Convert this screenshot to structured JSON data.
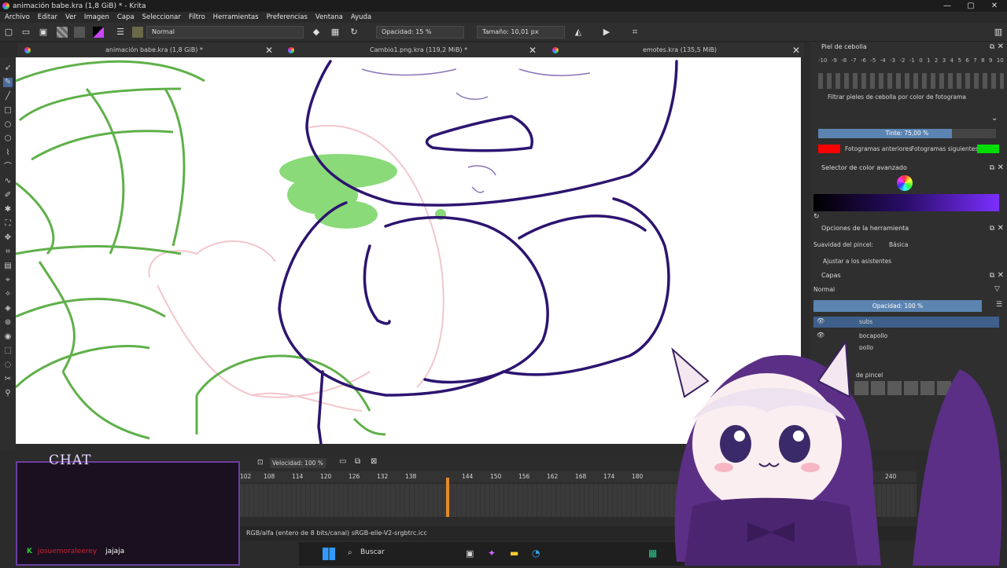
{
  "window": {
    "title": "animación babe.kra (1,8 GiB) * - Krita",
    "minimize": "—",
    "maximize": "▢",
    "close": "✕"
  },
  "menu": [
    "Archivo",
    "Editar",
    "Ver",
    "Imagen",
    "Capa",
    "Seleccionar",
    "Filtro",
    "Herramientas",
    "Preferencias",
    "Ventana",
    "Ayuda"
  ],
  "toolbar": {
    "blend_mode": "Normal",
    "opacity": "Opacidad: 15 %",
    "size": "Tamaño: 10,01 px"
  },
  "tabs": [
    {
      "label": "animación babe.kra (1,8 GiB) *"
    },
    {
      "label": "Cambio1.png.kra (119,2 MiB) *"
    },
    {
      "label": "emotes.kra (135,5 MiB)"
    }
  ],
  "onion": {
    "title": "Piel de cebolla",
    "numbers": [
      "-10",
      "-9",
      "-8",
      "-7",
      "-6",
      "-5",
      "-4",
      "-3",
      "-2",
      "-1",
      "0",
      "1",
      "2",
      "3",
      "4",
      "5",
      "6",
      "7",
      "8",
      "9",
      "10"
    ],
    "filter_label": "Filtrar pieles de cebolla por color de fotograma",
    "tint": "Tinte: 75,00 %",
    "prev_label": "Fotogramas anteriores",
    "next_label": "Fotogramas siguientes",
    "tint_fill": 0.75,
    "prev_color": "#ff0000",
    "next_color": "#00dd00"
  },
  "color_selector": {
    "title": "Selector de color avanzado"
  },
  "tool_options": {
    "title": "Opciones de la herramienta",
    "smoothing_label": "Suavidad del pincel:",
    "smoothing_value": "Básica",
    "assistants": "Ajustar a los asistentes"
  },
  "layers": {
    "title": "Capas",
    "blend": "Normal",
    "opacity": "Opacidad:  100 %",
    "items": [
      {
        "name": "subs"
      },
      {
        "name": "bocapollo"
      },
      {
        "name": "pollo"
      }
    ]
  },
  "brush_presets": {
    "title": "de pincel"
  },
  "timeline": {
    "speed": "Velocidad: 100 %",
    "frames": [
      "102",
      "108",
      "114",
      "120",
      "126",
      "132",
      "138",
      "144",
      "150",
      "156",
      "162",
      "168",
      "174",
      "180",
      "240"
    ]
  },
  "status": {
    "text": "RGB/alfa (entero de 8 bits/canal)  sRGB-elle-V2-srgbtrc.icc"
  },
  "chat": {
    "title": "CHAT",
    "user": "josuemoraleerey",
    "message": "jajaja"
  },
  "taskbar": {
    "search": "Buscar"
  },
  "colors": {
    "accent": "#5b84b1",
    "chat_border": "#6b3fa0",
    "green_stroke": "#5fb04a",
    "purple_stroke": "#2d1470"
  }
}
